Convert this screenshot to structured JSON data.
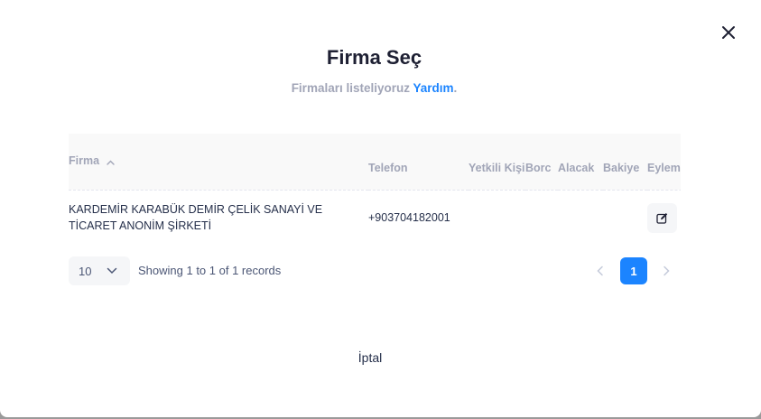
{
  "modal": {
    "title": "Firma Seç",
    "subtitle_text": "Firmaları listeliyoruz",
    "help_link": "Yardım",
    "subtitle_end": "."
  },
  "table": {
    "columns": [
      "Firma",
      "Telefon",
      "Yetkili Kişi",
      "Borc",
      "Alacak",
      "Bakiye",
      "Eylem"
    ],
    "rows": [
      {
        "firma": "KARDEMİR KARABÜK DEMİR ÇELİK SANAYİ VE TİCARET ANONİM ŞİRKETİ",
        "telefon": "+903704182001",
        "yetkili": "",
        "borc": "",
        "alacak": "",
        "bakiye": ""
      }
    ]
  },
  "pagination": {
    "page_size": "10",
    "records_info": "Showing 1 to 1 of 1 records",
    "current_page": "1"
  },
  "footer": {
    "cancel_label": "İptal"
  },
  "icons": {
    "close": "close-icon",
    "sort": "sort-ascending-icon",
    "edit": "edit-icon",
    "dropdown": "chevron-down-icon",
    "prev": "chevron-left-icon",
    "next": "chevron-right-icon"
  },
  "colors": {
    "accent": "#1b84ff",
    "muted_text": "#a1a5b7",
    "title_text": "#1e2033"
  }
}
